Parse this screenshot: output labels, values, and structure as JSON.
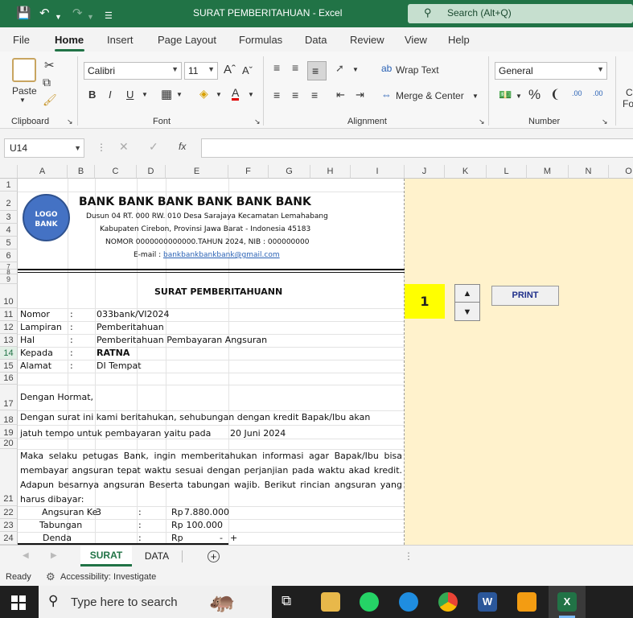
{
  "window": {
    "title": "SURAT PEMBERITAHUAN  -  Excel",
    "search_placeholder": "Search (Alt+Q)"
  },
  "menu": [
    "File",
    "Home",
    "Insert",
    "Page Layout",
    "Formulas",
    "Data",
    "Review",
    "View",
    "Help"
  ],
  "ribbon": {
    "clipboard": {
      "paste": "Paste",
      "label": "Clipboard"
    },
    "font": {
      "name": "Calibri",
      "size": "11",
      "label": "Font",
      "bold": "B",
      "italic": "I",
      "underline": "U"
    },
    "alignment": {
      "wrap": "Wrap Text",
      "merge": "Merge & Center",
      "label": "Alignment"
    },
    "number": {
      "format": "General",
      "label": "Number",
      "percent": "%"
    },
    "cut_off": {
      "line1": "C",
      "line2": "Fo"
    }
  },
  "formula_bar": {
    "cell_ref": "U14",
    "fx": "fx"
  },
  "columns": [
    "A",
    "B",
    "C",
    "D",
    "E",
    "F",
    "G",
    "H",
    "I",
    "J",
    "K",
    "L",
    "M",
    "N",
    "O"
  ],
  "rows": [
    "1",
    "2",
    "3",
    "4",
    "5",
    "6",
    "7",
    "8",
    "9",
    "10",
    "11",
    "12",
    "13",
    "14",
    "15",
    "16",
    "17",
    "18",
    "19",
    "20",
    "21",
    "22",
    "23",
    "24"
  ],
  "letter": {
    "logo": "LOGO BANK",
    "bank_name": "BANK BANK BANK BANK BANK BANK",
    "address1": "Dusun 04 RT. 000 RW. 010 Desa Sarajaya Kecamatan Lemahabang",
    "address2": "Kabupaten Cirebon, Provinsi Jawa Barat - Indonesia 45183",
    "nomor_line": "NOMOR 0000000000000.TAHUN 2024, NIB : 000000000",
    "email_label": "E-mail : ",
    "email": "bankbankbankbank@gmail.com",
    "subject_title": "SURAT PEMBERITAHUANN",
    "fields": [
      {
        "label": "Nomor",
        "sep": ":",
        "value": "033bank/VI2024"
      },
      {
        "label": "Lampiran",
        "sep": ":",
        "value": "Pemberitahuan"
      },
      {
        "label": "Hal",
        "sep": ":",
        "value": "Pemberitahuan Pembayaran Angsuran"
      },
      {
        "label": "Kepada",
        "sep": ":",
        "value": "RATNA"
      },
      {
        "label": "Alamat",
        "sep": ":",
        "value": "DI Tempat"
      }
    ],
    "greeting": "Dengan Hormat,",
    "para1": "Dengan surat ini kami beritahukan, sehubungan dengan kredit Bapak/Ibu akan",
    "para2": "jatuh tempo untuk pembayaran yaitu pada",
    "due_date": "20 Juni 2024",
    "para3": [
      "Maka selaku petugas Bank, ingin memberitahukan informasi agar Bapak/Ibu bisa",
      "membayar angsuran tepat waktu sesuai dengan perjanjian pada waktu akad kredit.",
      "Adapun besarnya angsuran Beserta tabungan wajib. Berikut rincian angsuran yang",
      "harus dibayar:"
    ],
    "items": [
      {
        "label": "Angsuran Ke",
        "num": "3",
        "sep": ":",
        "cur": "Rp",
        "amount": "7.880.000"
      },
      {
        "label": "Tabungan",
        "num": "",
        "sep": ":",
        "cur": "Rp",
        "amount": "100.000"
      },
      {
        "label": "Denda",
        "num": "",
        "sep": ":",
        "cur": "Rp",
        "amount": "-"
      }
    ],
    "plus": "+"
  },
  "controls": {
    "counter": "1",
    "print": "PRINT"
  },
  "tabs": [
    "SURAT",
    "DATA"
  ],
  "status": {
    "ready": "Ready",
    "accessibility": "Accessibility: Investigate"
  },
  "taskbar": {
    "search": "Type here to search"
  }
}
